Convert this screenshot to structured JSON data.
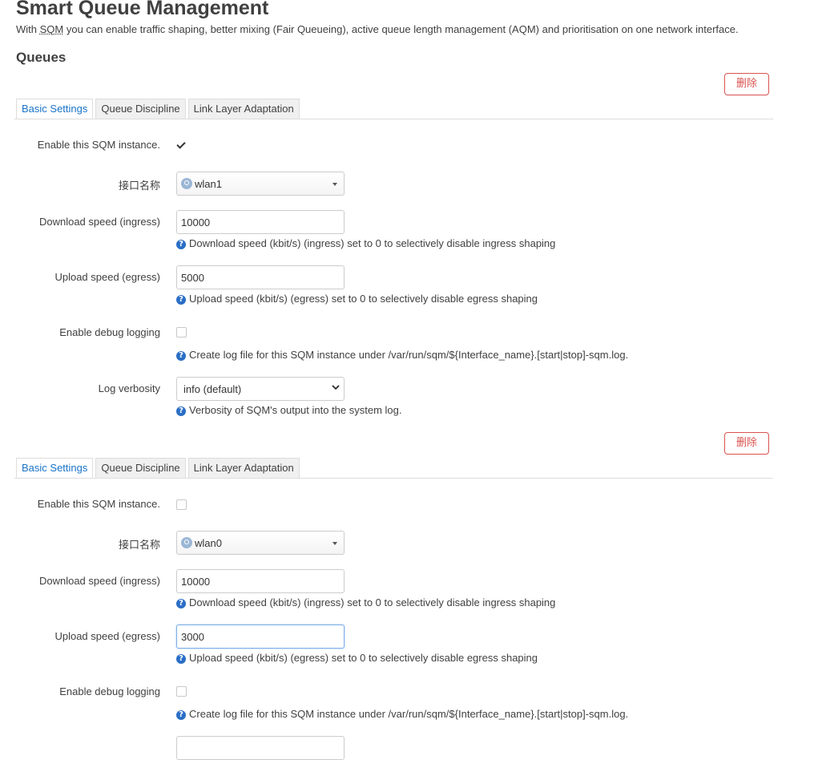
{
  "header": {
    "title": "Smart Queue Management",
    "desc_prefix": "With ",
    "desc_abbr": "SQM",
    "desc_suffix": " you can enable traffic shaping, better mixing (Fair Queueing), active queue length management (AQM) and prioritisation on one network interface.",
    "section": "Queues"
  },
  "labels": {
    "delete": "删除",
    "tab_basic": "Basic Settings",
    "tab_qdisc": "Queue Discipline",
    "tab_linklayer": "Link Layer Adaptation",
    "enable": "Enable this SQM instance.",
    "interface": "接口名称",
    "download": "Download speed (ingress)",
    "upload": "Upload speed (egress)",
    "debug": "Enable debug logging",
    "verbosity": "Log verbosity",
    "download_hint": "Download speed (kbit/s) (ingress) set to 0 to selectively disable ingress shaping",
    "upload_hint": "Upload speed (kbit/s) (egress) set to 0 to selectively disable egress shaping",
    "debug_hint": "Create log file for this SQM instance under /var/run/sqm/${Interface_name}.[start|stop]-sqm.log.",
    "verbosity_hint": "Verbosity of SQM's output into the system log.",
    "help_icon": "?"
  },
  "instances": [
    {
      "enabled": true,
      "interface": "wlan1",
      "download": "10000",
      "upload": "5000",
      "debug": false,
      "verbosity": "info (default)"
    },
    {
      "enabled": false,
      "interface": "wlan0",
      "download": "10000",
      "upload": "3000",
      "debug": false
    }
  ],
  "colors": {
    "accent": "#1a73c8",
    "danger": "#d9534f"
  }
}
